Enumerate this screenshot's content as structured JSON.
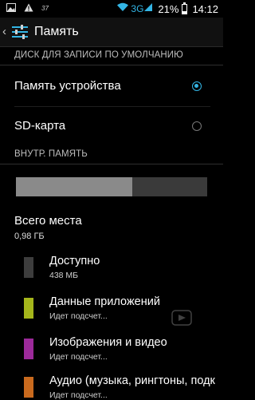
{
  "status_bar": {
    "left_icons": [
      "image-icon",
      "warning-icon",
      "signal-37-icon"
    ],
    "network": "3G",
    "battery_percent_text": "21%",
    "battery_level": 0.21,
    "time": "14:12"
  },
  "action_bar": {
    "title": "Память"
  },
  "default_disk": {
    "header": "ДИСК ДЛЯ ЗАПИСИ ПО УМОЛЧАНИЮ",
    "options": [
      {
        "label": "Память устройства",
        "selected": true
      },
      {
        "label": "SD-карта",
        "selected": false
      }
    ]
  },
  "internal": {
    "header": "ВНУТР. ПАМЯТЬ",
    "usage_fraction_used": 0.61,
    "total_title": "Всего места",
    "total_value": "0,98 ГБ",
    "categories": [
      {
        "title": "Доступно",
        "subtitle": "438 МБ",
        "color": "#3d3d3d"
      },
      {
        "title": "Данные приложений",
        "subtitle": "Идет подсчет...",
        "color": "#a5b61b"
      },
      {
        "title": "Изображения и видео",
        "subtitle": "Идет подсчет...",
        "color": "#9c2a9a"
      },
      {
        "title": "Аудио (музыка, рингтоны, подк",
        "subtitle": "Идет подсчет...",
        "color": "#c96a1e"
      }
    ]
  },
  "colors": {
    "accent": "#33b5e5"
  }
}
